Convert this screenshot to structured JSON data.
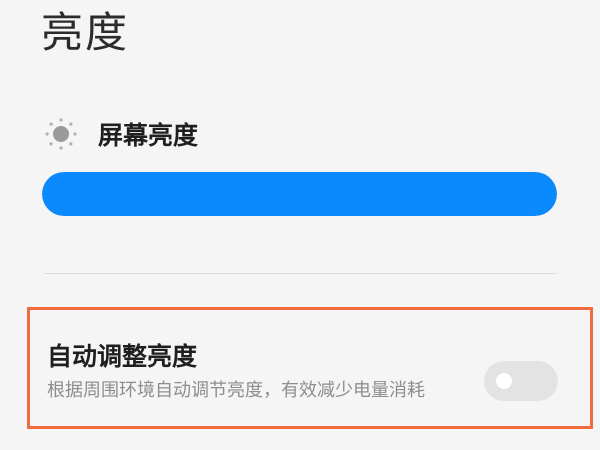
{
  "page": {
    "title": "亮度"
  },
  "brightness": {
    "icon": "sun-icon",
    "label": "屏幕亮度",
    "level_percent": 100,
    "fill_color": "#0a8afc"
  },
  "auto_brightness": {
    "title": "自动调整亮度",
    "description": "根据周围环境自动调节亮度，有效减少电量消耗",
    "enabled": false,
    "highlight_color": "#f26a3f"
  }
}
